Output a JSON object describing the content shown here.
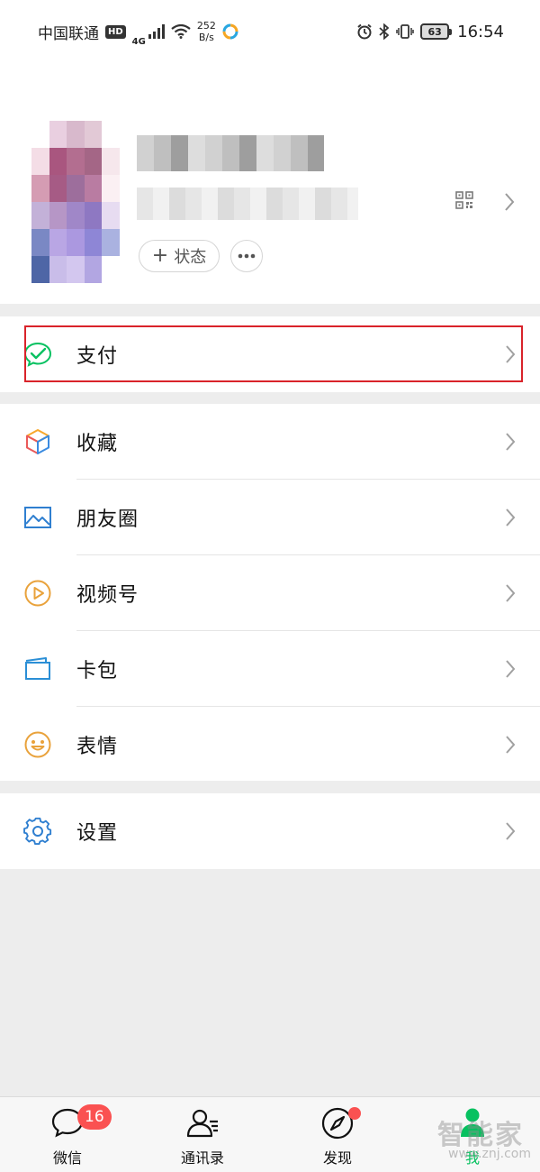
{
  "status_bar": {
    "carrier": "中国联通",
    "hd": "HD",
    "network": "4G",
    "speed_value": "252",
    "speed_unit": "B/s",
    "battery": "63",
    "time": "16:54"
  },
  "profile": {
    "status_label": "状态"
  },
  "menu": {
    "pay": {
      "label": "支付",
      "icon": "wechat-pay-icon"
    },
    "items": [
      {
        "label": "收藏",
        "icon": "favorites-cube-icon"
      },
      {
        "label": "朋友圈",
        "icon": "moments-picture-icon"
      },
      {
        "label": "视频号",
        "icon": "channels-play-icon"
      },
      {
        "label": "卡包",
        "icon": "card-wallet-icon"
      },
      {
        "label": "表情",
        "icon": "sticker-smile-icon"
      }
    ],
    "settings": {
      "label": "设置",
      "icon": "gear-icon"
    }
  },
  "tabbar": {
    "tabs": [
      {
        "label": "微信",
        "badge": "16"
      },
      {
        "label": "通讯录"
      },
      {
        "label": "发现"
      },
      {
        "label": "我"
      }
    ]
  },
  "watermark": {
    "big": "智能家",
    "small": "www.znj.com"
  },
  "colors": {
    "accent_green": "#07c160",
    "badge_red": "#fa5151",
    "highlight_red": "#d9232a",
    "background": "#ededed"
  }
}
